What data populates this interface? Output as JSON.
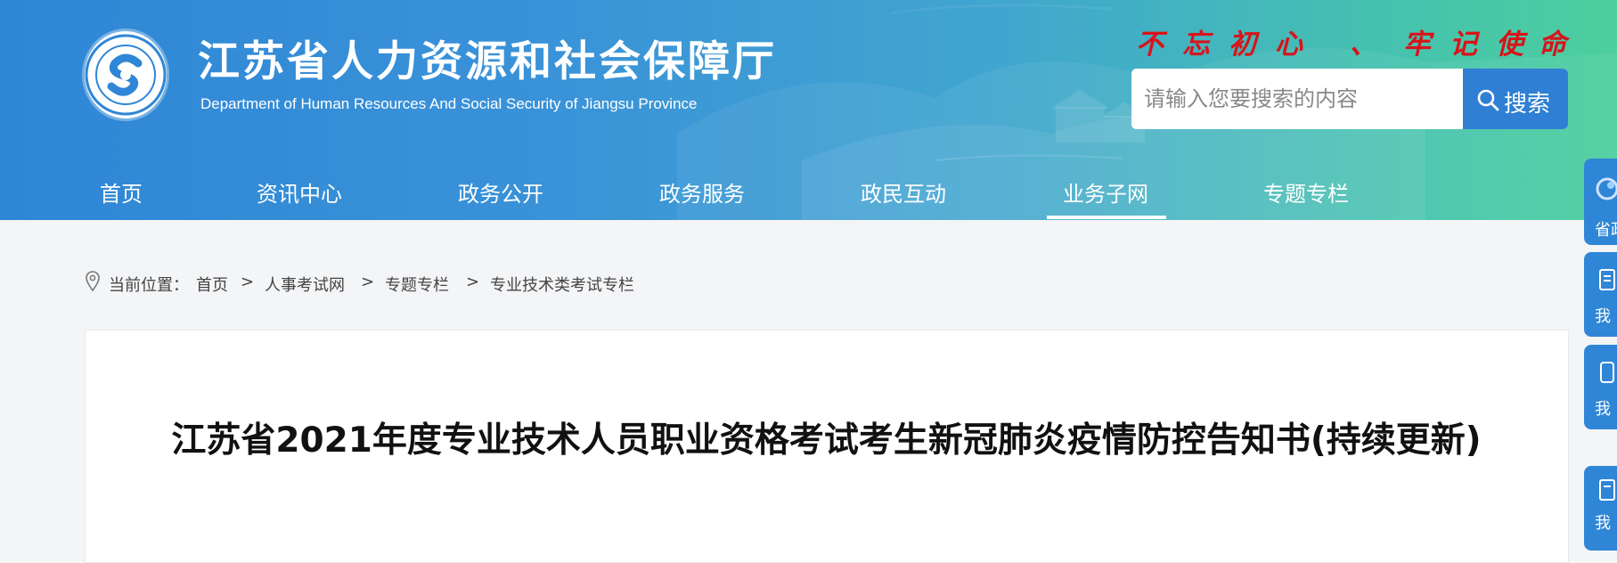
{
  "header": {
    "title": "江苏省人力资源和社会保障厅",
    "subtitle": "Department of Human Resources And Social Security of Jiangsu Province",
    "slogan": [
      "不",
      "忘",
      "初",
      "心",
      "、",
      "牢",
      "记",
      "使",
      "命"
    ],
    "slogan_color": "#d7141b"
  },
  "search": {
    "placeholder": "请输入您要搜索的内容",
    "button_label": "搜索"
  },
  "nav": {
    "items": [
      "首页",
      "资讯中心",
      "政务公开",
      "政务服务",
      "政民互动",
      "业务子网",
      "专题专栏"
    ],
    "active": "业务子网"
  },
  "breadcrumb": {
    "prefix": "当前位置：",
    "items": [
      "首页",
      "人事考试网",
      "专题专栏",
      "专业技术类考试专栏"
    ],
    "separator": ">"
  },
  "article": {
    "title": "江苏省2021年度专业技术人员职业资格考试考生新冠肺炎疫情防控告知书(持续更新)"
  },
  "side_tabs": [
    "省政",
    "我",
    "我",
    "我"
  ],
  "colors": {
    "brand_blue": "#2f86d6",
    "header_green": "#4dcf9e",
    "search_button": "#2f7fd4"
  }
}
